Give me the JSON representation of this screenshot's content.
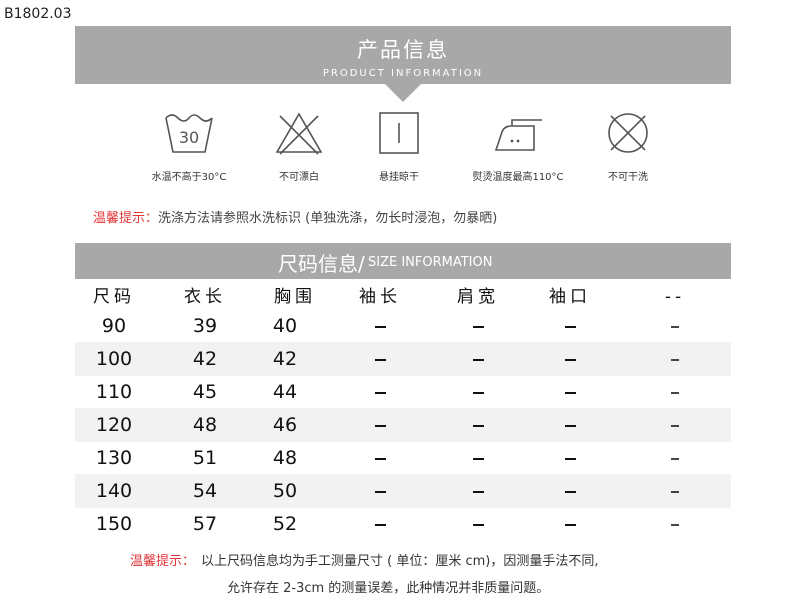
{
  "product_code": "B1802.03",
  "product_info": {
    "title_cn": "产品信息",
    "title_en": "PRODUCT INFORMATION"
  },
  "care_icons": [
    {
      "icon": "wash-30-icon",
      "symbol": "30",
      "label": "水温不高于30°C"
    },
    {
      "icon": "no-bleach-icon",
      "label": "不可漂白"
    },
    {
      "icon": "hang-dry-icon",
      "label": "悬挂晾干"
    },
    {
      "icon": "iron-icon",
      "label": "熨烫温度最高110°C"
    },
    {
      "icon": "no-dry-clean-icon",
      "label": "不可干洗"
    }
  ],
  "wash_tip": {
    "prefix": "温馨提示：",
    "text": "洗涤方法请参照水洗标识 (单独洗涤，勿长时浸泡，勿暴晒)"
  },
  "size_info": {
    "title_cn": "尺码信息/",
    "title_en": "SIZE INFORMATION"
  },
  "size_table": {
    "headers": [
      "尺码",
      "衣长",
      "胸围",
      "袖长",
      "肩宽",
      "袖口",
      "--"
    ],
    "rows": [
      [
        "90",
        "39",
        "40",
        "–",
        "–",
        "–",
        "–"
      ],
      [
        "100",
        "42",
        "42",
        "–",
        "–",
        "–",
        "–"
      ],
      [
        "110",
        "45",
        "44",
        "–",
        "–",
        "–",
        "–"
      ],
      [
        "120",
        "48",
        "46",
        "–",
        "–",
        "–",
        "–"
      ],
      [
        "130",
        "51",
        "48",
        "–",
        "–",
        "–",
        "–"
      ],
      [
        "140",
        "54",
        "50",
        "–",
        "–",
        "–",
        "–"
      ],
      [
        "150",
        "57",
        "52",
        "–",
        "–",
        "–",
        "–"
      ]
    ]
  },
  "size_note": {
    "prefix": "温馨提示：",
    "line1": "以上尺码信息均为手工测量尺寸 ( 单位：厘米 cm)，因测量手法不同,",
    "line2": "允许存在 2-3cm 的测量误差，此种情况并非质量问题。"
  },
  "colors": {
    "banner": "#a8a8a8",
    "tip": "#e0383a",
    "row_shade": "#f2f2f2"
  }
}
